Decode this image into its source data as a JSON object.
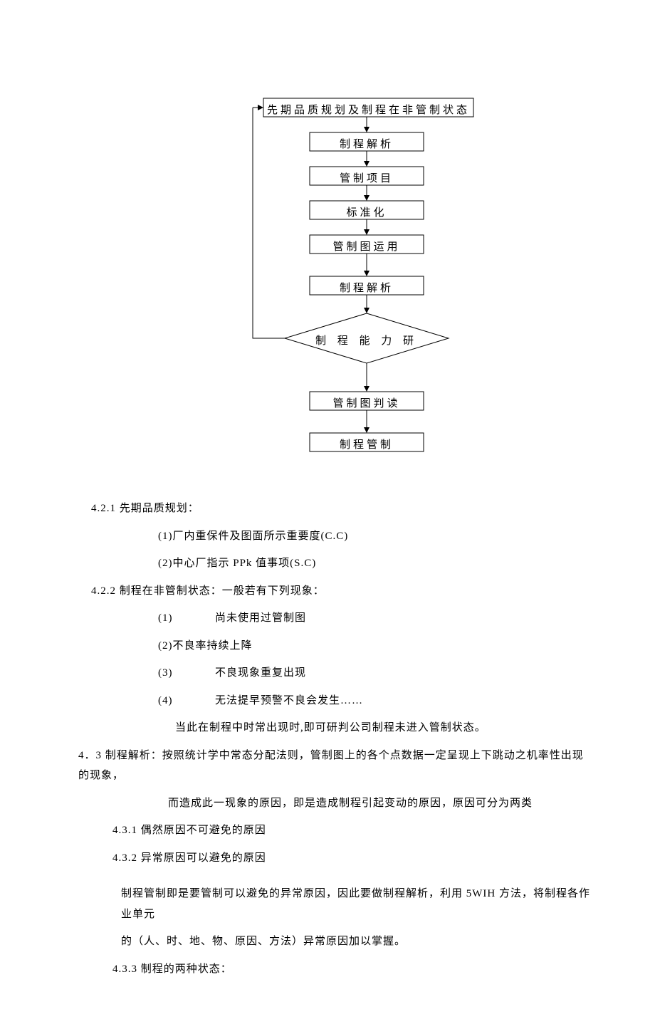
{
  "flow": {
    "n1": "先期品质规划及制程在非管制状态",
    "n2": "制程解析",
    "n3": "管制项目",
    "n4": "标准化",
    "n5": "管制图运用",
    "n6": "制程解析",
    "n7": "制 程 能 力 研",
    "n8": "管制图判读",
    "n9": "制程管制"
  },
  "body": {
    "s421_title": "4.2.1 先期品质规划：",
    "s421_1": "(1)厂内重保件及图面所示重要度(C.C)",
    "s421_2": "(2)中心厂指示 PPk 值事项(S.C)",
    "s422_title": "4.2.2 制程在非管制状态：一般若有下列现象：",
    "s422_1a": "(1)",
    "s422_1b": "尚未使用过管制图",
    "s422_2": "(2)不良率持续上降",
    "s422_3a": "(3)",
    "s422_3b": "不良现象重复出现",
    "s422_4a": "(4)",
    "s422_4b": "无法提早预警不良会发生……",
    "s422_note": "当此在制程中时常出现时,即可研判公司制程未进入管制状态。",
    "s43_title": "4．3 制程解析：按照统计学中常态分配法则，管制图上的各个点数据一定呈现上下跳动之机率性出现的现象，",
    "s43_cont": "而造成此一现象的原因，即是造成制程引起变动的原因，原因可分为两类",
    "s431": "4.3.1 偶然原因不可避免的原因",
    "s432": "4.3.2 异常原因可以避免的原因",
    "s432_p1": "制程管制即是要管制可以避免的异常原因，因此要做制程解析，利用 5WIH 方法，将制程各作业单元",
    "s432_p2": "的（人、时、地、物、原因、方法）异常原因加以掌握。",
    "s433": "4.3.3 制程的两种状态："
  }
}
